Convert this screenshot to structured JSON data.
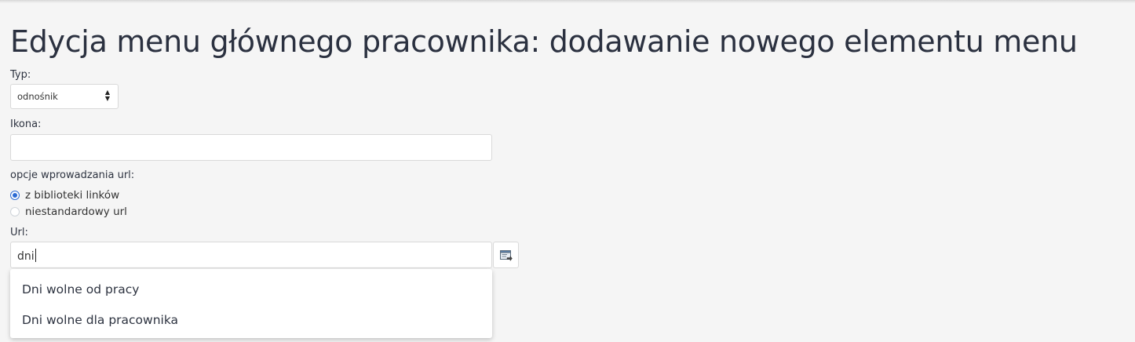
{
  "page": {
    "title": "Edycja menu głównego pracownika: dodawanie nowego elementu menu"
  },
  "form": {
    "type": {
      "label": "Typ:",
      "selected": "odnośnik"
    },
    "icon": {
      "label": "Ikona:",
      "value": ""
    },
    "url_options": {
      "label": "opcje wprowadzania url:",
      "options": [
        {
          "label": "z biblioteki linków",
          "checked": true
        },
        {
          "label": "niestandardowy url",
          "checked": false
        }
      ]
    },
    "url": {
      "label": "Url:",
      "value": "dni",
      "picker_icon": "link-picker-icon",
      "suggestions": [
        "Dni wolne od pracy",
        "Dni wolne dla pracownika"
      ]
    }
  },
  "colors": {
    "background": "#f5f5f5",
    "accent": "#2d6bd3",
    "text": "#2d3340"
  }
}
